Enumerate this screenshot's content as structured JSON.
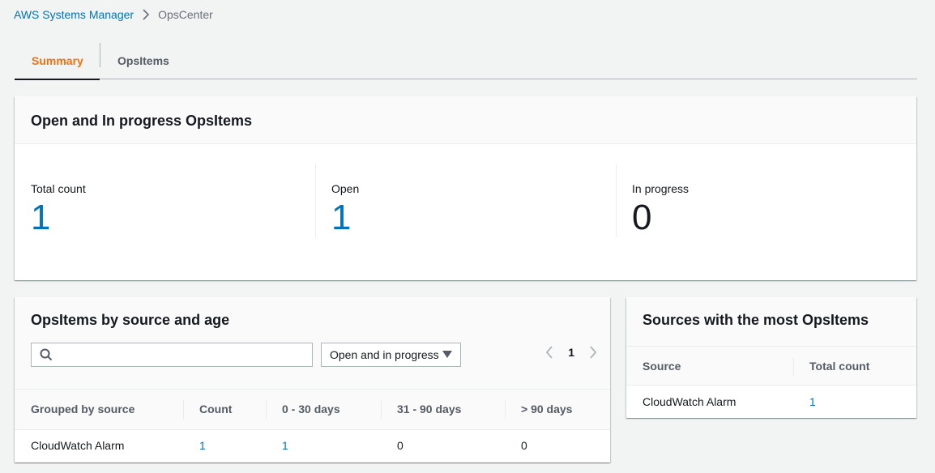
{
  "breadcrumb": {
    "root": "AWS Systems Manager",
    "current": "OpsCenter"
  },
  "tabs": [
    {
      "label": "Summary",
      "active": true
    },
    {
      "label": "OpsItems",
      "active": false
    }
  ],
  "open_panel": {
    "title": "Open and In progress OpsItems",
    "counts": [
      {
        "label": "Total count",
        "value": "1"
      },
      {
        "label": "Open",
        "value": "1"
      },
      {
        "label": "In progress",
        "value": "0"
      }
    ]
  },
  "age_panel": {
    "title": "OpsItems by source and age",
    "search_value": "",
    "filter_selected": "Open and in progress",
    "page": "1",
    "columns": [
      "Grouped by source",
      "Count",
      "0 - 30 days",
      "31 - 90 days",
      "> 90 days"
    ],
    "rows": [
      {
        "source": "CloudWatch Alarm",
        "count": "1",
        "d0_30": "1",
        "d31_90": "0",
        "d90": "0"
      }
    ]
  },
  "sources_panel": {
    "title": "Sources with the most OpsItems",
    "columns": [
      "Source",
      "Total count"
    ],
    "rows": [
      {
        "source": "CloudWatch Alarm",
        "total": "1"
      }
    ]
  },
  "colors": {
    "link": "#0073bb",
    "active_tab": "#ec7211",
    "background": "#f2f3f3"
  }
}
